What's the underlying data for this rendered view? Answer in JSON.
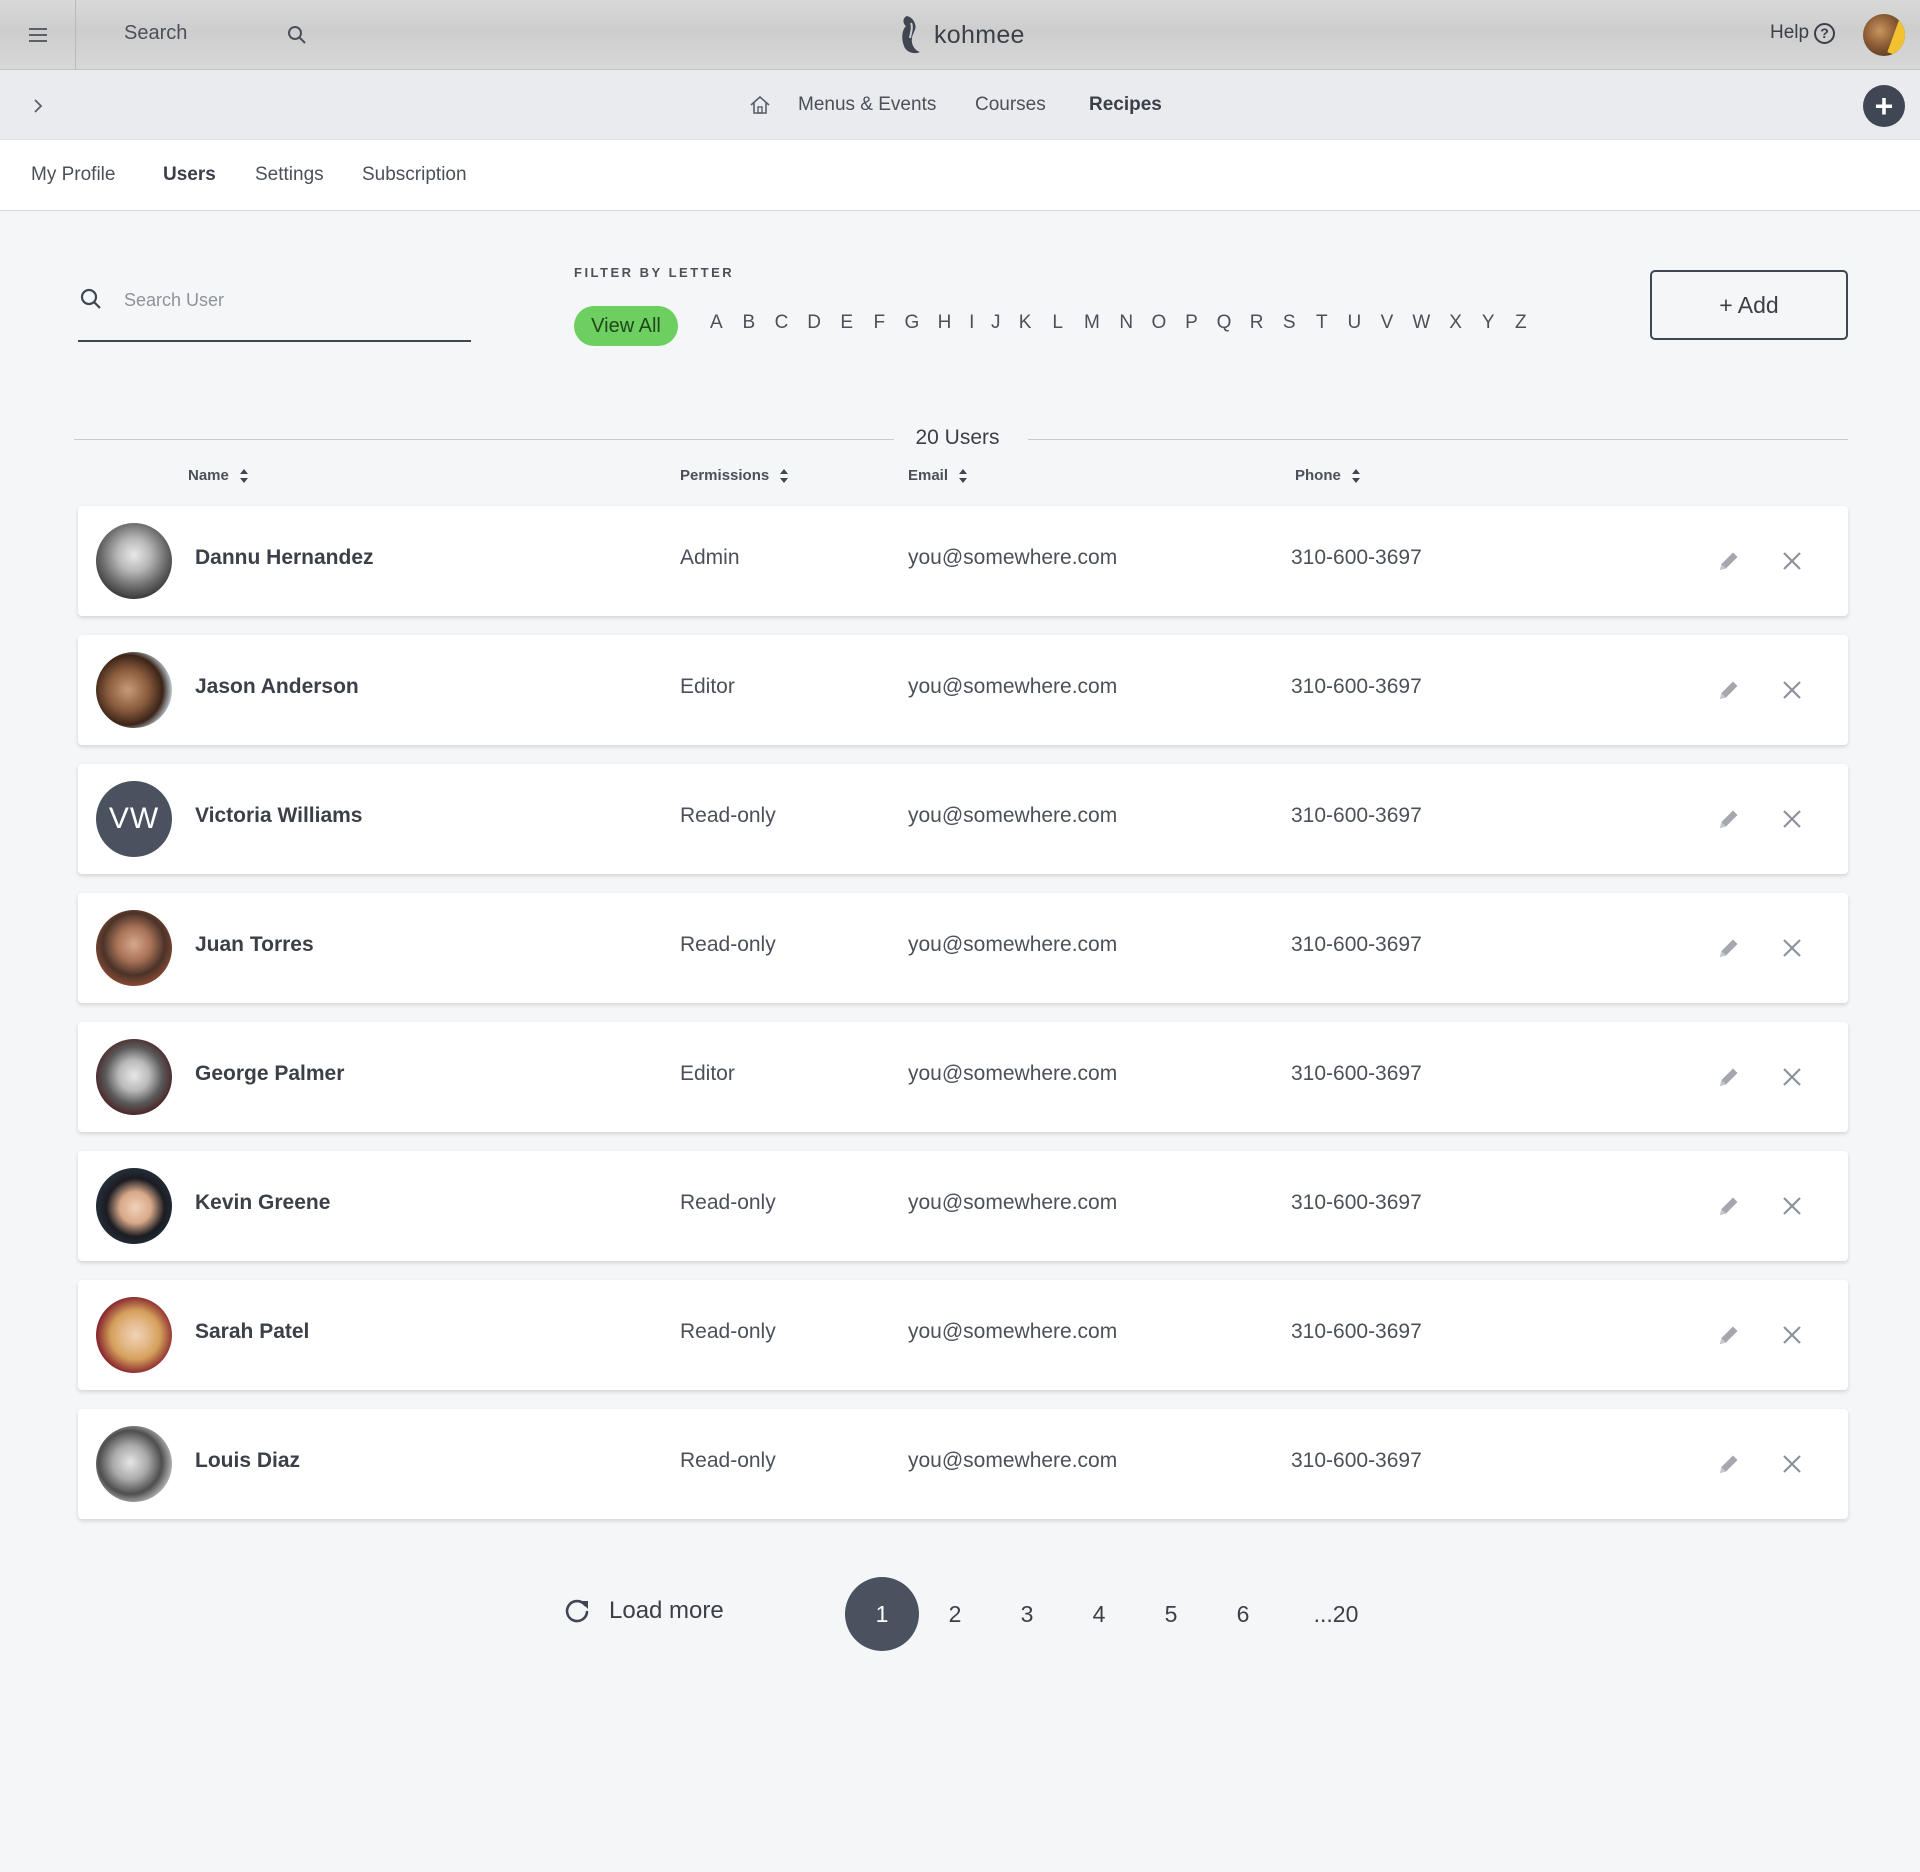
{
  "topbar": {
    "search_label": "Search",
    "brand": "kohmee",
    "help_label": "Help",
    "help_symbol": "?"
  },
  "nav": {
    "links": [
      "Menus & Events",
      "Courses",
      "Recipes"
    ],
    "active": "Recipes",
    "add_symbol": "+"
  },
  "subnav": {
    "links": [
      "My Profile",
      "Users",
      "Settings",
      "Subscription"
    ],
    "active": "Users"
  },
  "filters": {
    "search_placeholder": "Search User",
    "filter_label": "FILTER BY LETTER",
    "view_all": "View All",
    "letters": [
      "A",
      "B",
      "C",
      "D",
      "E",
      "F",
      "G",
      "H",
      "I",
      "J",
      "K",
      "L",
      "M",
      "N",
      "O",
      "P",
      "Q",
      "R",
      "S",
      "T",
      "U",
      "V",
      "W",
      "X",
      "Y",
      "Z"
    ],
    "add_button": "+ Add"
  },
  "table": {
    "count_label": "20 Users",
    "headers": {
      "name": "Name",
      "permissions": "Permissions",
      "email": "Email",
      "phone": "Phone"
    },
    "rows": [
      {
        "name": "Dannu Hernandez",
        "permission": "Admin",
        "email": "you@somewhere.com",
        "phone": "310-600-3697",
        "avatar": "photo"
      },
      {
        "name": "Jason Anderson",
        "permission": "Editor",
        "email": "you@somewhere.com",
        "phone": "310-600-3697",
        "avatar": "photo"
      },
      {
        "name": "Victoria Williams",
        "permission": "Read-only",
        "email": "you@somewhere.com",
        "phone": "310-600-3697",
        "avatar": "initials",
        "initials": "VW"
      },
      {
        "name": "Juan Torres",
        "permission": "Read-only",
        "email": "you@somewhere.com",
        "phone": "310-600-3697",
        "avatar": "photo"
      },
      {
        "name": "George Palmer",
        "permission": "Editor",
        "email": "you@somewhere.com",
        "phone": "310-600-3697",
        "avatar": "photo"
      },
      {
        "name": "Kevin Greene",
        "permission": "Read-only",
        "email": "you@somewhere.com",
        "phone": "310-600-3697",
        "avatar": "photo"
      },
      {
        "name": "Sarah Patel",
        "permission": "Read-only",
        "email": "you@somewhere.com",
        "phone": "310-600-3697",
        "avatar": "photo"
      },
      {
        "name": "Louis Diaz",
        "permission": "Read-only",
        "email": "you@somewhere.com",
        "phone": "310-600-3697",
        "avatar": "photo"
      }
    ]
  },
  "pagination": {
    "load_more": "Load more",
    "pages": [
      "1",
      "2",
      "3",
      "4",
      "5",
      "6",
      "...20"
    ],
    "current": "1"
  },
  "colors": {
    "accent_green": "#6ccf5f",
    "dark_slate": "#4a5260",
    "background": "#f5f6f8"
  },
  "icons": [
    "menu-icon",
    "search-icon",
    "kohmee-logo-icon",
    "help-icon",
    "chevron-right-icon",
    "home-icon",
    "plus-icon",
    "sort-icon",
    "pencil-icon",
    "close-icon",
    "refresh-icon"
  ]
}
